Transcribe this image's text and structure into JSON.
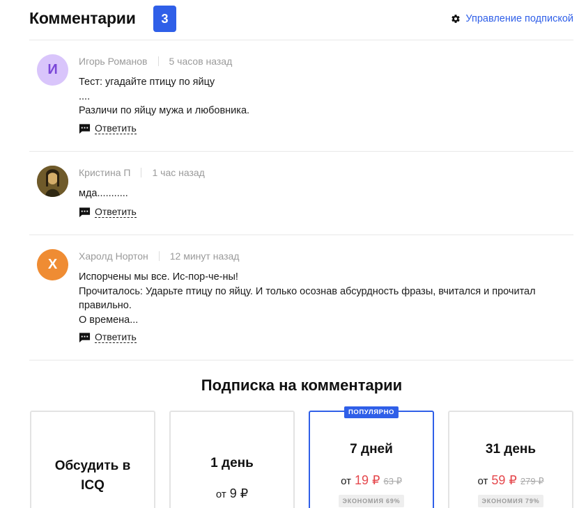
{
  "header": {
    "title": "Комментарии",
    "count": "3",
    "manage_label": "Управление подпиской"
  },
  "comments": [
    {
      "author": "Игорь Романов",
      "avatar_letter": "И",
      "time": "5 часов назад",
      "lines": [
        "Тест: угадайте птицу по яйцу",
        "....",
        "Различи по яйцу мужа и любовника."
      ],
      "reply_label": "Ответить"
    },
    {
      "author": "Кристина П",
      "avatar_letter": "",
      "time": "1 час назад",
      "lines": [
        "мда..........."
      ],
      "reply_label": "Ответить"
    },
    {
      "author": "Харолд Нортон",
      "avatar_letter": "Х",
      "time": "12 минут назад",
      "lines": [
        "Испорчены мы все. Ис-пор-че-ны!",
        "Прочиталось: Ударьте птицу по яйцу. И только осознав абсурдность фразы, вчитался и прочитал",
        "правильно.",
        "О времена..."
      ],
      "reply_label": "Ответить"
    }
  ],
  "subscription": {
    "title": "Подписка на комментарии",
    "plans": [
      {
        "name_line1": "Обсудить в",
        "name_line2": "ICQ"
      },
      {
        "name": "1 день",
        "price_prefix": "от",
        "price": "9 ₽"
      },
      {
        "name": "7 дней",
        "price_prefix": "от",
        "price": "19 ₽",
        "old_price": "63 ₽",
        "saving": "ЭКОНОМИЯ 69%",
        "tag": "ПОПУЛЯРНО"
      },
      {
        "name": "31 день",
        "price_prefix": "от",
        "price": "59 ₽",
        "old_price": "279 ₽",
        "saving": "ЭКОНОМИЯ 79%"
      }
    ]
  },
  "colors": {
    "accent": "#2f5fe8",
    "price_red": "#e5484d",
    "avatar_purple_bg": "#d9c5fb",
    "avatar_orange_bg": "#ef8c33"
  },
  "icons": {
    "manage": "gear-icon",
    "reply": "comment-bubble-icon"
  }
}
